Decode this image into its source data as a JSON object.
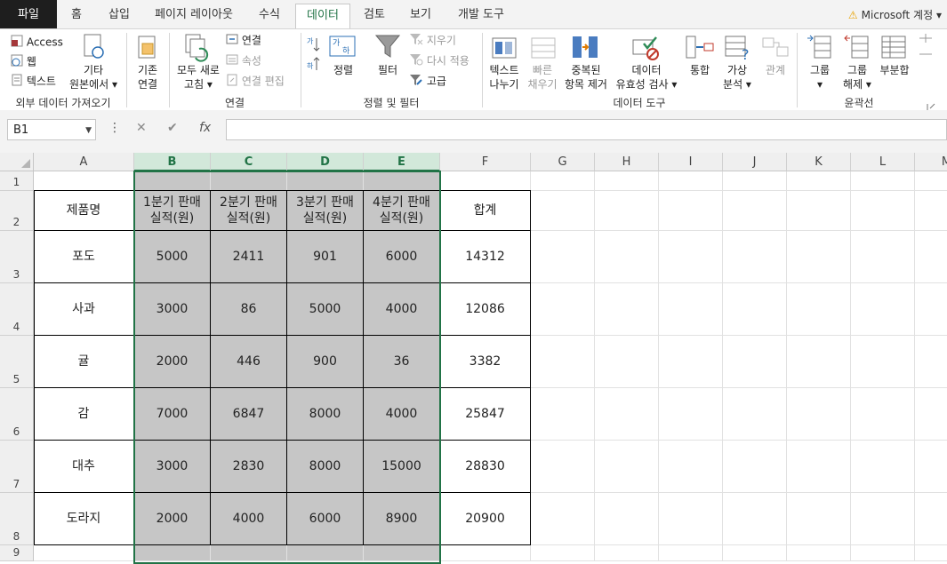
{
  "tabs": [
    {
      "label": "파일",
      "kind": "file"
    },
    {
      "label": "홈"
    },
    {
      "label": "삽입"
    },
    {
      "label": "페이지 레이아웃"
    },
    {
      "label": "수식"
    },
    {
      "label": "데이터",
      "kind": "active"
    },
    {
      "label": "검토"
    },
    {
      "label": "보기"
    },
    {
      "label": "개발 도구"
    }
  ],
  "account": {
    "label": "Microsoft 계정",
    "caret": "▾",
    "warn_icon": "⚠"
  },
  "ribbon": {
    "external": {
      "access": "Access",
      "web": "웹",
      "text": "텍스트",
      "other_line1": "기타",
      "other_line2": "원본에서 ▾",
      "group": "외부 데이터 가져오기"
    },
    "connections": {
      "existing_line1": "기존",
      "existing_line2": "연결",
      "refresh_line1": "모두 새로",
      "refresh_line2": "고침 ▾",
      "conn": "연결",
      "props": "속성",
      "edit_links": "연결 편집",
      "group": "연결"
    },
    "sort": {
      "sort": "정렬",
      "filter": "필터",
      "clear": "지우기",
      "reapply": "다시 적용",
      "advanced": "고급",
      "group": "정렬 및 필터"
    },
    "tools": {
      "text_cols_1": "텍스트",
      "text_cols_2": "나누기",
      "flash_1": "빠른",
      "flash_2": "채우기",
      "dup_1": "중복된",
      "dup_2": "항목 제거",
      "valid_1": "데이터",
      "valid_2": "유효성 검사 ▾",
      "consolidate": "통합",
      "whatif_1": "가상",
      "whatif_2": "분석 ▾",
      "relations": "관계",
      "group": "데이터 도구"
    },
    "outline": {
      "group_btn_1": "그룹",
      "group_btn_2": "▾",
      "ungroup_1": "그룹",
      "ungroup_2": "해제 ▾",
      "subtotal": "부분합",
      "group": "윤곽선"
    }
  },
  "formula_bar": {
    "name_box": "B1",
    "fx": "fx",
    "cancel": "✕",
    "enter": "✔",
    "more": "⋮",
    "value": ""
  },
  "columns": [
    "A",
    "B",
    "C",
    "D",
    "E",
    "F",
    "G",
    "H",
    "I",
    "J",
    "K",
    "L",
    "M"
  ],
  "rows": [
    "1",
    "2",
    "3",
    "4",
    "5",
    "6",
    "7",
    "8",
    "9"
  ],
  "table": {
    "headers": [
      "제품명",
      "1분기 판매\n실적(원)",
      "2분기 판매\n실적(원)",
      "3분기 판매\n실적(원)",
      "4분기 판매\n실적(원)",
      "합계"
    ],
    "data": [
      [
        "포도",
        "5000",
        "2411",
        "901",
        "6000",
        "14312"
      ],
      [
        "사과",
        "3000",
        "86",
        "5000",
        "4000",
        "12086"
      ],
      [
        "귤",
        "2000",
        "446",
        "900",
        "36",
        "3382"
      ],
      [
        "감",
        "7000",
        "6847",
        "8000",
        "4000",
        "25847"
      ],
      [
        "대추",
        "3000",
        "2830",
        "8000",
        "15000",
        "28830"
      ],
      [
        "도라지",
        "2000",
        "4000",
        "6000",
        "8900",
        "20900"
      ]
    ]
  }
}
